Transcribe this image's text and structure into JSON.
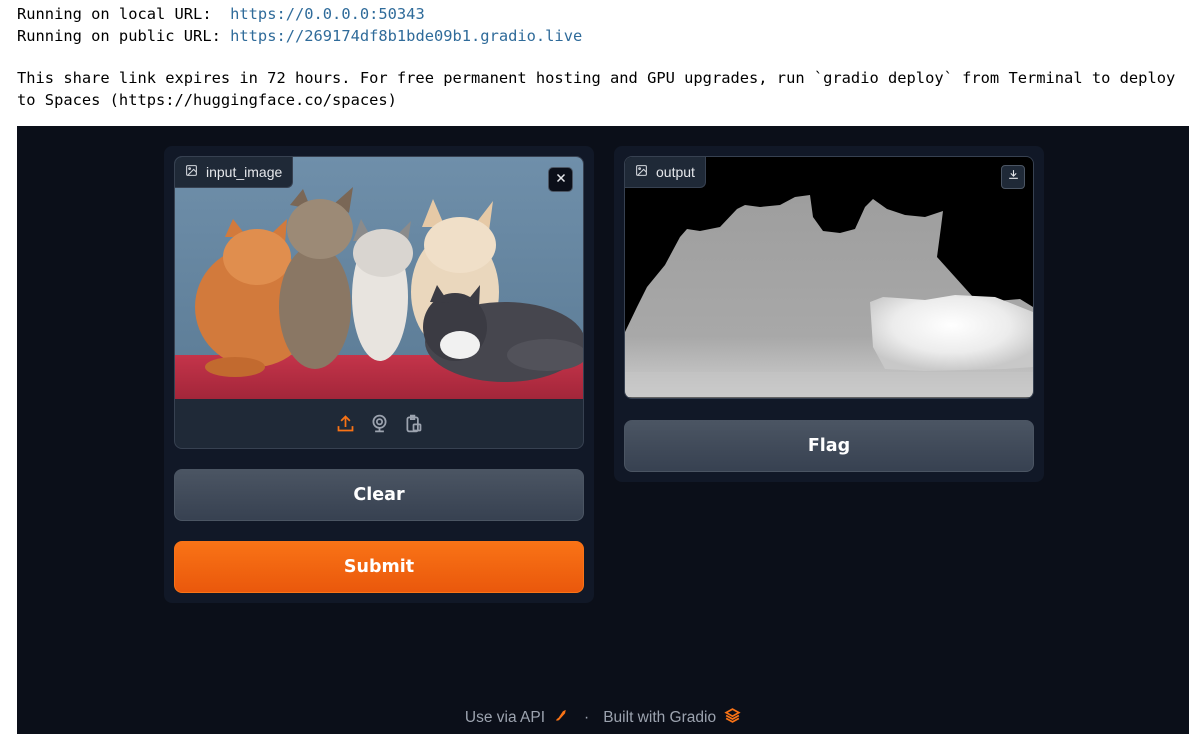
{
  "console": {
    "local_prefix": "Running on local URL:  ",
    "local_url": "https://0.0.0.0:50343",
    "public_prefix": "Running on public URL: ",
    "public_url": "https://269174df8b1bde09b1.gradio.live",
    "notice": "This share link expires in 72 hours. For free permanent hosting and GPU upgrades, run `gradio deploy` from Terminal to deploy to Spaces (https://huggingface.co/spaces)"
  },
  "input": {
    "label": "input_image",
    "label_icon": "image-icon",
    "close_icon": "close-icon",
    "sources": [
      "upload-icon",
      "webcam-icon",
      "clipboard-icon"
    ]
  },
  "output": {
    "label": "output",
    "label_icon": "image-icon",
    "download_icon": "download-icon"
  },
  "buttons": {
    "clear": "Clear",
    "submit": "Submit",
    "flag": "Flag"
  },
  "footer": {
    "api_label": "Use via API",
    "separator": "·",
    "built_label": "Built with Gradio"
  },
  "colors": {
    "app_bg": "#0b0f19",
    "panel_bg": "#111827",
    "primary": "#f97316",
    "secondary": "#4b5563",
    "url": "#2f6b9a"
  }
}
